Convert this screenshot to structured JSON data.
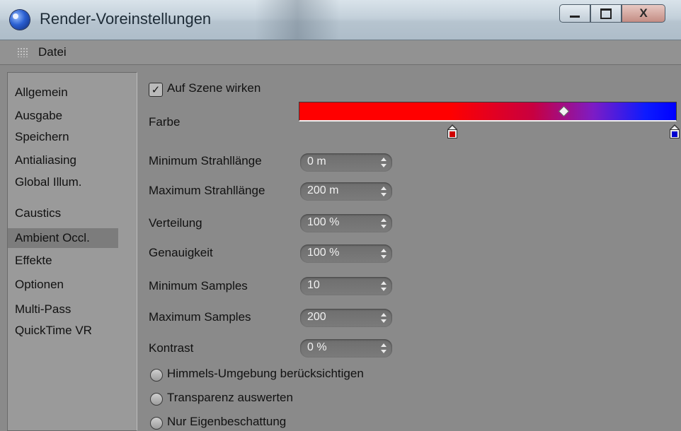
{
  "window": {
    "title": "Render-Voreinstellungen",
    "icon": "cinema4d-sphere-icon",
    "buttons": [
      "minimize",
      "maximize",
      "close"
    ],
    "close_glyph": "X"
  },
  "menubar": {
    "file": "Datei"
  },
  "sidebar": {
    "items": [
      {
        "label": "Allgemein"
      },
      {
        "label": "Ausgabe"
      },
      {
        "label": "Speichern"
      },
      {
        "label": "Antialiasing"
      },
      {
        "label": "Global Illum."
      },
      {
        "label": "Caustics"
      },
      {
        "label": "Ambient Occl.",
        "active": true
      },
      {
        "label": "Effekte"
      },
      {
        "label": "Optionen"
      },
      {
        "label": "Multi-Pass"
      },
      {
        "label": "QuickTime VR"
      }
    ]
  },
  "settings": {
    "apply_scene": {
      "label": "Auf Szene wirken",
      "checked": true
    },
    "color": {
      "label": "Farbe",
      "gradient_from": "#ff0000",
      "gradient_to": "#0000ff",
      "knots": [
        {
          "color": "#d00000"
        },
        {
          "color": "#0000d0"
        }
      ]
    },
    "fields": [
      {
        "label": "Minimum Strahllänge",
        "value": "0 m"
      },
      {
        "label": "Maximum Strahllänge",
        "value": "200 m"
      },
      {
        "label": "Verteilung",
        "value": "100 %"
      },
      {
        "label": "Genauigkeit",
        "value": "100 %"
      },
      {
        "label": "Minimum Samples",
        "value": "10"
      },
      {
        "label": "Maximum Samples",
        "value": "200"
      },
      {
        "label": "Kontrast",
        "value": "0 %"
      }
    ],
    "options": [
      {
        "label": "Himmels-Umgebung berücksichtigen",
        "checked": false
      },
      {
        "label": "Transparenz auswerten",
        "checked": false
      },
      {
        "label": "Nur Eigenbeschattung",
        "checked": false
      }
    ]
  }
}
